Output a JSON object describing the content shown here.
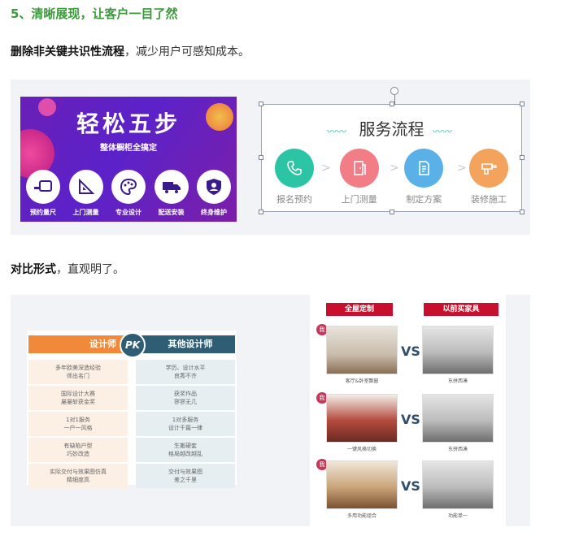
{
  "heading": "5、清晰展现，让客户一目了然",
  "para1": {
    "bold": "删除非关键共识性流程",
    "rest": "，减少用户可感知成本。"
  },
  "para2": {
    "bold": "对比形式",
    "rest": "，直观明了。"
  },
  "promo": {
    "title": "轻松五步",
    "subtitle": "整体橱柜全搞定",
    "items": [
      {
        "label": "预约量尺",
        "icon": "tape-measure-icon"
      },
      {
        "label": "上门测量",
        "icon": "ruler-triangle-icon"
      },
      {
        "label": "专业设计",
        "icon": "palette-icon"
      },
      {
        "label": "配送安装",
        "icon": "truck-icon"
      },
      {
        "label": "终身维护",
        "icon": "shield-user-icon"
      }
    ]
  },
  "flow": {
    "title": "服务流程",
    "steps": [
      {
        "label": "报名预约",
        "icon": "phone-icon",
        "color": "#2bc5a6"
      },
      {
        "label": "上门测量",
        "icon": "door-icon",
        "color": "#f27d86"
      },
      {
        "label": "制定方案",
        "icon": "document-icon",
        "color": "#5ab1e8"
      },
      {
        "label": "装修施工",
        "icon": "drill-icon",
        "color": "#f3a35c"
      }
    ]
  },
  "compare": {
    "left_title": "设计师",
    "right_title": "其他设计师",
    "pk": "PK",
    "left": [
      [
        "多年欧美深造经验",
        "师出名门"
      ],
      [
        "国际设计大赛",
        "屡屡斩获金奖"
      ],
      [
        "1对1服务",
        "一户一风格"
      ],
      [
        "有缺陷户型",
        "巧妙改造"
      ],
      [
        "实际交付与效果图仿真",
        "精细度高"
      ]
    ],
    "right": [
      [
        "学历、设计水平",
        "良莠不齐"
      ],
      [
        "获奖作品",
        "寥寥无几"
      ],
      [
        "1对多服务",
        "设计千篇一律"
      ],
      [
        "生搬硬套",
        "格局越改越乱"
      ],
      [
        "交付与效果图",
        "差之千里"
      ]
    ]
  },
  "vs_panel": {
    "left_head": "全屋定制",
    "right_head": "以前买家具",
    "mark": "我",
    "vs": "VS",
    "rows": [
      {
        "left_caption": "客厅&卧室飘窗",
        "right_caption": "东拼西凑"
      },
      {
        "left_caption": "一键风格切换",
        "right_caption": "东拼西凑"
      },
      {
        "left_caption": "多用功能组合",
        "right_caption": "功能单一"
      }
    ]
  }
}
